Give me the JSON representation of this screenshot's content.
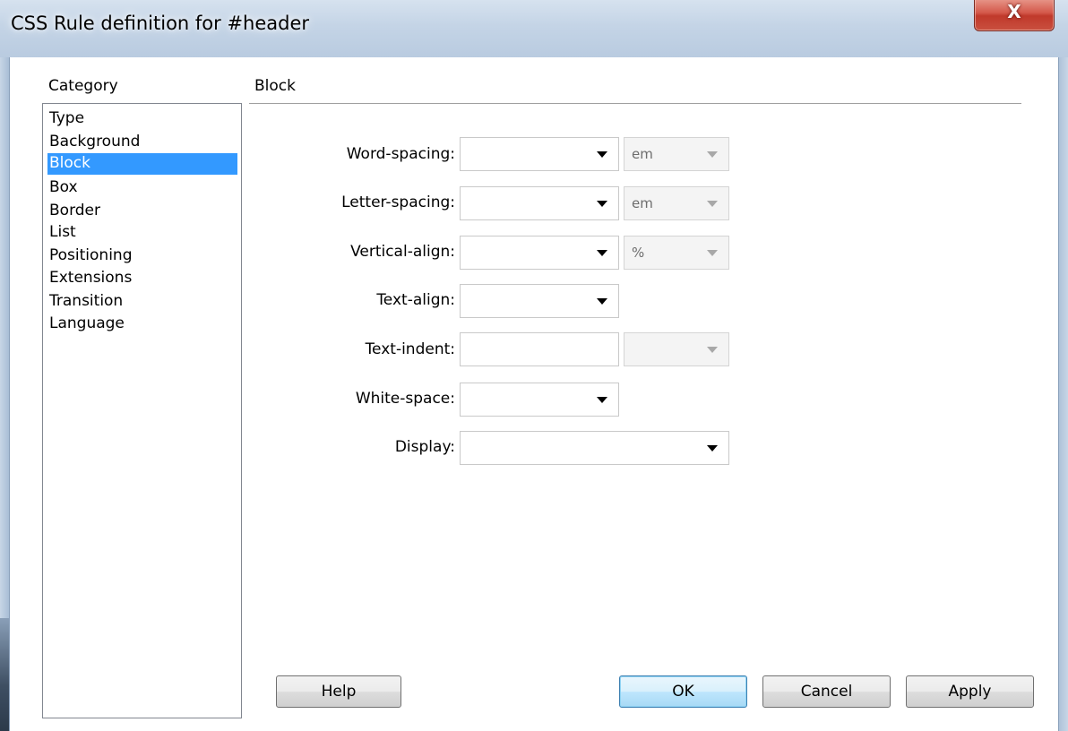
{
  "window": {
    "title": "CSS Rule definition for #header",
    "close_glyph": "X"
  },
  "category": {
    "label": "Category",
    "items": [
      "Type",
      "Background",
      "Block",
      "Box",
      "Border",
      "List",
      "Positioning",
      "Extensions",
      "Transition",
      "Language"
    ],
    "selected": "Block"
  },
  "panel": {
    "title": "Block",
    "fields": {
      "word_spacing": {
        "label": "Word-spacing:",
        "value": "",
        "unit": "em"
      },
      "letter_spacing": {
        "label": "Letter-spacing:",
        "value": "",
        "unit": "em"
      },
      "vertical_align": {
        "label": "Vertical-align:",
        "value": "",
        "unit": "%"
      },
      "text_align": {
        "label": "Text-align:",
        "value": ""
      },
      "text_indent": {
        "label": "Text-indent:",
        "value": "",
        "unit": ""
      },
      "white_space": {
        "label": "White-space:",
        "value": ""
      },
      "display": {
        "label": "Display:",
        "value": ""
      }
    }
  },
  "buttons": {
    "help": "Help",
    "ok": "OK",
    "cancel": "Cancel",
    "apply": "Apply"
  },
  "colors": {
    "selection": "#3399ff",
    "close_button": "#c9503f"
  }
}
